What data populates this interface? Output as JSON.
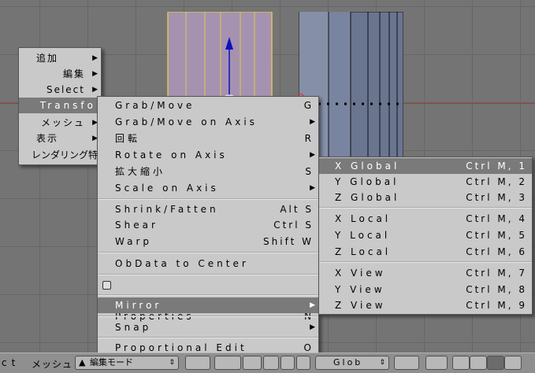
{
  "context_menu": {
    "items": [
      {
        "label": "追加"
      },
      {
        "label": "編集"
      },
      {
        "label": "Select"
      },
      {
        "label": "Transfo"
      },
      {
        "label": "メッシュ"
      },
      {
        "label": "表示"
      },
      {
        "label": "レンダリング特"
      }
    ]
  },
  "transform_menu": {
    "items": [
      {
        "label": "Grab/Move",
        "shortcut": "G"
      },
      {
        "label": "Grab/Move on Axis",
        "shortcut": ""
      },
      {
        "label": "回転",
        "shortcut": "R"
      },
      {
        "label": "Rotate on Axis",
        "shortcut": ""
      },
      {
        "label": "拡大縮小",
        "shortcut": "S"
      },
      {
        "label": "Scale on Axis",
        "shortcut": ""
      },
      {
        "label": "Shrink/Fatten",
        "shortcut": "Alt S"
      },
      {
        "label": "Shear",
        "shortcut": "Ctrl S"
      },
      {
        "label": "Warp",
        "shortcut": "Shift W"
      },
      {
        "label": "ObData to Center",
        "shortcut": ""
      },
      {
        "label": "Properties",
        "shortcut": "N"
      },
      {
        "label": "Mirror",
        "shortcut": ""
      },
      {
        "label": "Snap",
        "shortcut": ""
      },
      {
        "label": "Proportional Edit",
        "shortcut": "O"
      }
    ]
  },
  "mirror_menu": {
    "items": [
      {
        "label": "X Global",
        "shortcut": "Ctrl M, 1"
      },
      {
        "label": "Y Global",
        "shortcut": "Ctrl M, 2"
      },
      {
        "label": "Z Global",
        "shortcut": "Ctrl M, 3"
      },
      {
        "label": "X Local",
        "shortcut": "Ctrl M, 4"
      },
      {
        "label": "Y Local",
        "shortcut": "Ctrl M, 5"
      },
      {
        "label": "Z Local",
        "shortcut": "Ctrl M, 6"
      },
      {
        "label": "X View",
        "shortcut": "Ctrl M, 7"
      },
      {
        "label": "Y View",
        "shortcut": "Ctrl M, 8"
      },
      {
        "label": "Z View",
        "shortcut": "Ctrl M, 9"
      }
    ]
  },
  "header": {
    "left_text": "ct",
    "mesh_menu": "メッシュ",
    "mode_select": "編集モード",
    "orientation": "Glob"
  },
  "icons": [
    "arrow-right-icon",
    "transform-icon",
    "hand-icon",
    "checkbox-icon",
    "mode-icon",
    "magnet-icon",
    "vertex-select-icon",
    "edge-select-icon",
    "face-select-icon",
    "occlude-icon"
  ],
  "colors": {
    "highlight": "#7a7a7a",
    "menu_bg": "#c9c9c9",
    "selected_mesh": "#a592b0",
    "mesh": "#6a7590"
  }
}
